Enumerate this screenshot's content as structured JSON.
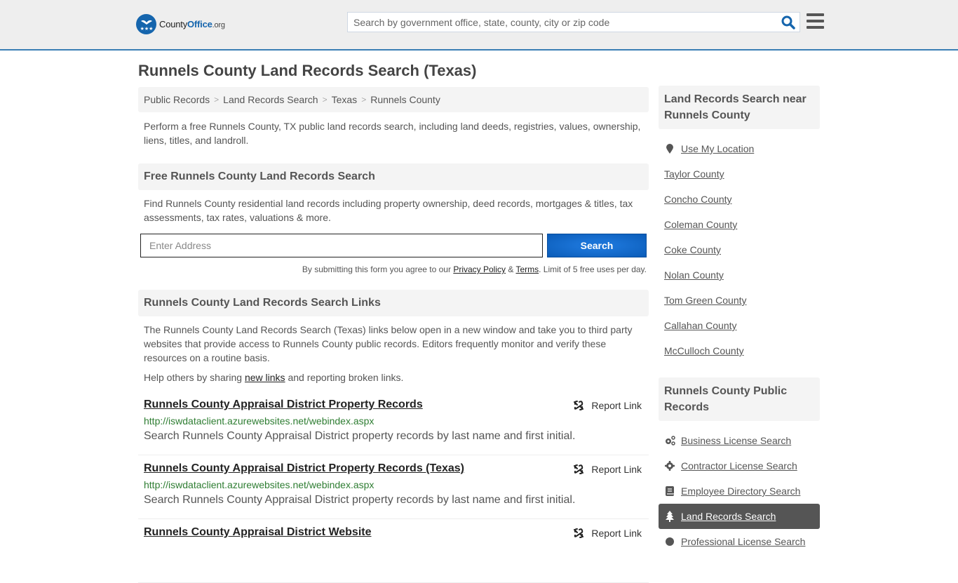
{
  "header": {
    "logo_county": "County",
    "logo_office": "Office",
    "logo_org": ".org",
    "search_placeholder": "Search by government office, state, county, city or zip code",
    "brand_color": "#1565ad"
  },
  "page_title": "Runnels County Land Records Search (Texas)",
  "breadcrumb": [
    "Public Records",
    "Land Records Search",
    "Texas",
    "Runnels County"
  ],
  "intro": "Perform a free Runnels County, TX public land records search, including land deeds, registries, values, ownership, liens, titles, and landroll.",
  "free_search": {
    "heading": "Free Runnels County Land Records Search",
    "text": "Find Runnels County residential land records including property ownership, deed records, mortgages & titles, tax assessments, tax rates, valuations & more.",
    "input_placeholder": "Enter Address",
    "button_label": "Search",
    "disclaimer_prefix": "By submitting this form you agree to our ",
    "privacy_label": "Privacy Policy",
    "amp": " & ",
    "terms_label": "Terms",
    "disclaimer_suffix": ". Limit of 5 free uses per day."
  },
  "links_section": {
    "heading": "Runnels County Land Records Search Links",
    "text": "The Runnels County Land Records Search (Texas) links below open in a new window and take you to third party websites that provide access to Runnels County public records. Editors frequently monitor and verify these resources on a routine basis.",
    "help_prefix": "Help others by sharing ",
    "help_link": "new links",
    "help_suffix": " and reporting broken links.",
    "report_label": "Report Link",
    "items": [
      {
        "title": "Runnels County Appraisal District Property Records",
        "url": "http://iswdataclient.azurewebsites.net/webindex.aspx",
        "description": "Search Runnels County Appraisal District property records by last name and first initial."
      },
      {
        "title": "Runnels County Appraisal District Property Records (Texas)",
        "url": "http://iswdataclient.azurewebsites.net/webindex.aspx",
        "description": "Search Runnels County Appraisal District property records by last name and first initial."
      },
      {
        "title": "Runnels County Appraisal District Website",
        "url": "",
        "description": ""
      }
    ]
  },
  "sidebar": {
    "nearby_heading": "Land Records Search near Runnels County",
    "use_location": "Use My Location",
    "nearby": [
      "Taylor County",
      "Concho County",
      "Coleman County",
      "Coke County",
      "Nolan County",
      "Tom Green County",
      "Callahan County",
      "McCulloch County"
    ],
    "public_heading": "Runnels County Public Records",
    "public_items": [
      {
        "label": "Business License Search",
        "icon": "gears-icon",
        "active": false
      },
      {
        "label": "Contractor License Search",
        "icon": "gear-icon",
        "active": false
      },
      {
        "label": "Employee Directory Search",
        "icon": "book-icon",
        "active": false
      },
      {
        "label": "Land Records Search",
        "icon": "tree-icon",
        "active": true
      },
      {
        "label": "Professional License Search",
        "icon": "badge-icon",
        "active": false
      }
    ]
  }
}
